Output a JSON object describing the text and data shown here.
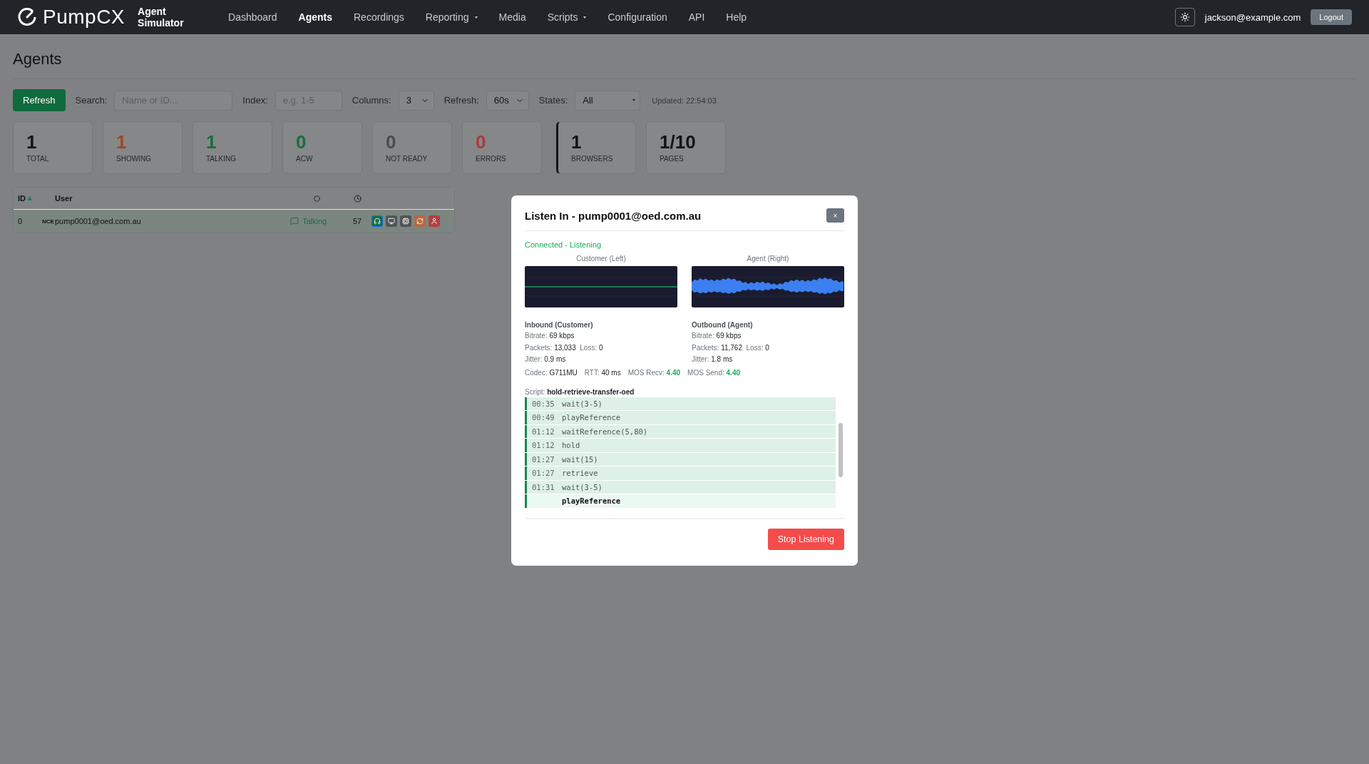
{
  "brand": {
    "logo": "PumpCX",
    "subtitle": "Agent Simulator"
  },
  "nav": [
    {
      "label": "Dashboard",
      "selected": false,
      "dropdown": false
    },
    {
      "label": "Agents",
      "selected": true,
      "dropdown": false
    },
    {
      "label": "Recordings",
      "selected": false,
      "dropdown": false
    },
    {
      "label": "Reporting",
      "selected": false,
      "dropdown": true
    },
    {
      "label": "Media",
      "selected": false,
      "dropdown": false
    },
    {
      "label": "Scripts",
      "selected": false,
      "dropdown": true
    },
    {
      "label": "Configuration",
      "selected": false,
      "dropdown": false
    },
    {
      "label": "API",
      "selected": false,
      "dropdown": false
    },
    {
      "label": "Help",
      "selected": false,
      "dropdown": false
    }
  ],
  "user": {
    "email": "jackson@example.com",
    "logout": "Logout"
  },
  "page_title": "Agents",
  "toolbar": {
    "refresh_button": "Refresh",
    "search_label": "Search:",
    "search_placeholder": "Name or ID...",
    "index_label": "Index:",
    "index_placeholder": "e.g. 1-5",
    "columns_label": "Columns:",
    "columns_value": "3",
    "refresh_label": "Refresh:",
    "refresh_value": "60s",
    "states_label": "States:",
    "states_value": "All",
    "updated": "Updated: 22:54:03"
  },
  "stats": [
    {
      "value": "1",
      "label": "TOTAL",
      "color": "#141414",
      "highlighted": false
    },
    {
      "value": "1",
      "label": "SHOWING",
      "color": "#9a4a26",
      "highlighted": false
    },
    {
      "value": "1",
      "label": "TALKING",
      "color": "#1d6b43",
      "highlighted": false
    },
    {
      "value": "0",
      "label": "ACW",
      "color": "#1d6b43",
      "highlighted": false
    },
    {
      "value": "0",
      "label": "NOT READY",
      "color": "#4a4d50",
      "highlighted": false
    },
    {
      "value": "0",
      "label": "ERRORS",
      "color": "#a83c3c",
      "highlighted": false
    },
    {
      "value": "1",
      "label": "BROWSERS",
      "color": "#141414",
      "highlighted": true
    },
    {
      "value": "1/10",
      "label": "PAGES",
      "color": "#141414",
      "highlighted": false
    }
  ],
  "table": {
    "columns": [
      "ID",
      "User"
    ],
    "rows": [
      {
        "id": "0",
        "tag": "NCE",
        "user": "pump0001@oed.com.au",
        "status": "Talking",
        "time": "57",
        "actions": [
          {
            "kind": "headset",
            "color": "#1a6b3f",
            "selected": true
          },
          {
            "kind": "monitor",
            "color": "#505458",
            "selected": false
          },
          {
            "kind": "chip",
            "color": "#505458",
            "selected": false
          },
          {
            "kind": "refresh",
            "color": "#b8683e",
            "selected": false
          },
          {
            "kind": "user",
            "color": "#b34040",
            "selected": false
          }
        ]
      }
    ]
  },
  "modal": {
    "title": "Listen In - pump0001@oed.com.au",
    "close": "×",
    "status": "Connected - Listening",
    "channels": [
      {
        "label": "Customer (Left)",
        "active": false
      },
      {
        "label": "Agent (Right)",
        "active": true
      }
    ],
    "stats": [
      {
        "heading": "Inbound (Customer)",
        "lines": [
          [
            {
              "label": "Bitrate:",
              "value": "69 kbps"
            }
          ],
          [
            {
              "label": "Packets:",
              "value": "13,033"
            },
            {
              "label": "Loss:",
              "value": "0"
            }
          ],
          [
            {
              "label": "Jitter:",
              "value": "0.9 ms"
            }
          ]
        ]
      },
      {
        "heading": "Outbound (Agent)",
        "lines": [
          [
            {
              "label": "Bitrate:",
              "value": "69 kbps"
            }
          ],
          [
            {
              "label": "Packets:",
              "value": "11,762"
            },
            {
              "label": "Loss:",
              "value": "0"
            }
          ],
          [
            {
              "label": "Jitter:",
              "value": "1.8 ms"
            }
          ]
        ]
      }
    ],
    "summary": [
      {
        "label": "Codec:",
        "value": "G711MU",
        "good": false
      },
      {
        "label": "RTT:",
        "value": "40 ms",
        "good": false
      },
      {
        "label": "MOS Recv:",
        "value": "4.40",
        "good": true
      },
      {
        "label": "MOS Send:",
        "value": "4.40",
        "good": true
      }
    ],
    "script_label": "Script:",
    "script_name": "hold-retrieve-transfer-oed",
    "script_lines": [
      {
        "time": "00:35",
        "command": "wait(3-5)",
        "current": false
      },
      {
        "time": "00:49",
        "command": "playReference",
        "current": false
      },
      {
        "time": "01:12",
        "command": "waitReference(5,80)",
        "current": false
      },
      {
        "time": "01:12",
        "command": "hold",
        "current": false
      },
      {
        "time": "01:27",
        "command": "wait(15)",
        "current": false
      },
      {
        "time": "01:27",
        "command": "retrieve",
        "current": false
      },
      {
        "time": "01:31",
        "command": "wait(3-5)",
        "current": false
      },
      {
        "command": "playReference",
        "current": true
      }
    ],
    "stop_button": "Stop Listening"
  }
}
